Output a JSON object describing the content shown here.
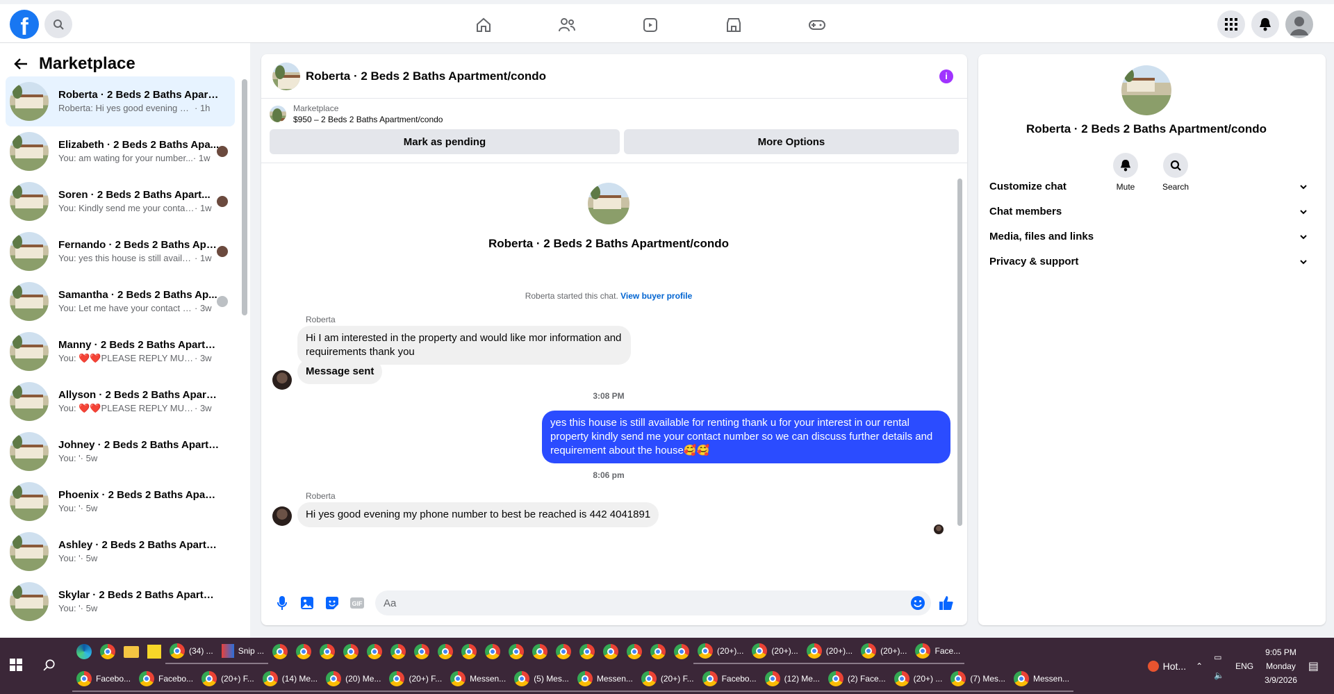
{
  "topbar": {
    "nav": [
      "home-icon",
      "friends-icon",
      "watch-icon",
      "marketplace-icon",
      "gaming-icon"
    ]
  },
  "sidebar": {
    "title": "Marketplace",
    "conversations": [
      {
        "title": "Roberta · 2 Beds 2 Baths Apartm...",
        "preview": "Roberta: Hi yes good evening my p...",
        "time": "· 1h",
        "active": true
      },
      {
        "title": "Elizabeth · 2 Beds 2 Baths Apa...",
        "preview": "You: am wating for your number...",
        "time": "· 1w"
      },
      {
        "title": "Soren · 2 Beds 2 Baths Apart...",
        "preview": "You: Kindly send me your contac...",
        "time": "· 1w"
      },
      {
        "title": "Fernando · 2 Beds 2 Baths Apart...",
        "preview": "You: yes this house is still available ...",
        "time": "· 1w"
      },
      {
        "title": "Samantha · 2 Beds 2 Baths Ap...",
        "preview": "You: Let me have your contact n...",
        "time": "· 3w"
      },
      {
        "title": "Manny · 2 Beds 2 Baths Apartm...",
        "preview": "You: ❤️❤️PLEASE REPLY MUST WI...",
        "time": "· 3w"
      },
      {
        "title": "Allyson · 2 Beds 2 Baths Apartm...",
        "preview": "You: ❤️❤️PLEASE REPLY MUST WI...",
        "time": "· 3w"
      },
      {
        "title": "Johney · 2 Beds 2 Baths Apartm...",
        "preview": "You: '",
        "time": "· 5w"
      },
      {
        "title": "Phoenix · 2 Beds 2 Baths Apart...",
        "preview": "You: '",
        "time": "· 5w"
      },
      {
        "title": "Ashley · 2 Beds 2 Baths Apartme...",
        "preview": "You: '",
        "time": "· 5w"
      },
      {
        "title": "Skylar · 2 Beds 2 Baths Apartme...",
        "preview": "You: '",
        "time": "· 5w"
      }
    ]
  },
  "chat": {
    "title": "Roberta · 2 Beds 2 Baths Apartment/condo",
    "marketplace_label": "Marketplace",
    "listing": "$950 – 2 Beds 2 Baths Apartment/condo",
    "btn_pending": "Mark as pending",
    "btn_more": "More Options",
    "started_text": "Roberta started this chat.",
    "view_profile": "View buyer profile",
    "sender1": "Roberta",
    "msg1": "Hi I am interested in the property and would like mor information and requirements thank you",
    "msg2": "Message sent",
    "time1": "3:08 PM",
    "msg3": "yes this house is still  available for renting thank u for your interest  in our rental property kindly send me your contact number so we can discuss further details and requirement about the house🥰🥰",
    "time2": "8:06 pm",
    "sender2": "Roberta",
    "msg4": "Hi yes good evening my phone number to best be reached is 442 4041891",
    "composer_placeholder": "Aa"
  },
  "details": {
    "name": "Roberta · 2 Beds 2 Baths Apartment/condo",
    "mute": "Mute",
    "search": "Search",
    "sections": [
      "Customize chat",
      "Chat members",
      "Media, files and links",
      "Privacy & support"
    ]
  },
  "taskbar": {
    "row1": [
      "(34) ...",
      "Snip ...",
      "(20+)...",
      "(20+)...",
      "(20+)...",
      "(20+)...",
      "Face..."
    ],
    "row2": [
      "Facebo...",
      "Facebo...",
      "(20+) F...",
      "(14) Me...",
      "(20) Me...",
      "(20+) F...",
      "Messen...",
      "(5) Mes...",
      "Messen...",
      "(20+) F...",
      "Facebo...",
      "(12) Me...",
      "(2) Face...",
      "(20+) ...",
      "(7) Mes...",
      "Messen..."
    ],
    "weather": "Hot...",
    "lang": "ENG",
    "time": "9:05 PM",
    "day": "Monday",
    "date": "3/9/2026"
  }
}
